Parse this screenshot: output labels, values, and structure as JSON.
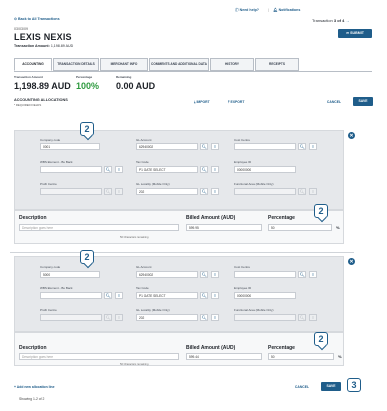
{
  "header": {
    "back_link": "Back to All Transactions",
    "need_help": "Need help?",
    "notifications": "Notifications",
    "transaction_counter_prefix": "Transaction",
    "transaction_counter_value": "3 of 4",
    "date": "03/03/09",
    "title": "LEXIS NEXIS",
    "amount_label": "Transaction Amount:",
    "amount_value": "1,198.89 AUD",
    "submit_label": "SUBMIT"
  },
  "tabs": [
    {
      "label": "ACCOUNTING",
      "active": true
    },
    {
      "label": "TRANSACTION DETAILS",
      "active": false
    },
    {
      "label": "MERCHANT INFO",
      "active": false
    },
    {
      "label": "COMMENTS AND ADDITIONAL DATA",
      "active": false
    },
    {
      "label": "HISTORY",
      "active": false
    },
    {
      "label": "RECEIPTS",
      "active": false
    }
  ],
  "summary": {
    "amount_label": "Transaction Amount",
    "amount_value": "1,198.89 AUD",
    "percentage_label": "Percentage",
    "percentage_value": "100%",
    "remaining_label": "Remaining",
    "remaining_value": "0.00 AUD"
  },
  "allocations_header": {
    "title": "ACCOUNTING ALLOCATIONS",
    "required": "* REQUIRED FIELDS",
    "import": "IMPORT",
    "export": "EXPORT",
    "cancel": "CANCEL",
    "save": "SAVE"
  },
  "allocations": [
    {
      "company_code_label": "Company code",
      "company_code": "0001",
      "gl_account_label": "GL Account",
      "gl_account": "62940002",
      "cost_centre_label": "Cost Centre",
      "cost_centre": "",
      "wbs_label": "WBS Element - Bu Back",
      "wbs": "",
      "tax_code_label": "Tax Code",
      "tax_code": "P1 GATE SELECT",
      "employee_label": "Employee ID",
      "employee": "00000000",
      "profit_centre_label": "Profit Centre",
      "profit_centre": "",
      "gl_locality_label": "GL Locality (Mobile Only)",
      "gl_locality": "202",
      "functional_area_label": "Functional Area (Mobile Only)",
      "functional_area": "",
      "description_label": "Description",
      "description_placeholder": "Description goes here",
      "chars_remaining": "50 Characters remaining",
      "billed_label": "Billed Amount (AUD)",
      "billed_value": "599.95",
      "percentage_label": "Percentage",
      "percentage_value": "50",
      "percent_sign": "%"
    },
    {
      "company_code_label": "Company code",
      "company_code": "5000",
      "gl_account_label": "GL Account",
      "gl_account": "62940002",
      "cost_centre_label": "Cost Centre",
      "cost_centre": "",
      "wbs_label": "WBS Element - Bu Back",
      "wbs": "",
      "tax_code_label": "Tax Code",
      "tax_code": "P1 GATE SELECT",
      "employee_label": "Employee ID",
      "employee": "00000000",
      "profit_centre_label": "Profit Centre",
      "profit_centre": "",
      "gl_locality_label": "GL Locality (Mobile Only)",
      "gl_locality": "202",
      "functional_area_label": "Functional Area (Mobile Only)",
      "functional_area": "",
      "description_label": "Description",
      "description_placeholder": "Description goes here",
      "chars_remaining": "50 Characters remaining",
      "billed_label": "Billed Amount (AUD)",
      "billed_value": "599.44",
      "percentage_label": "Percentage",
      "percentage_value": "50",
      "percent_sign": "%"
    }
  ],
  "footer": {
    "add_allocation": "+ Add new allocation line",
    "showing": "Showing 1-2 of 2",
    "cancel": "CANCEL",
    "save": "SAVE"
  },
  "callouts": {
    "top": "2",
    "bottom": "2",
    "pct_top": "2",
    "pct_bottom": "2",
    "save": "3"
  },
  "icons": {
    "search": "🔍︎",
    "list": "≡",
    "close": "✕"
  },
  "colors": {
    "accent": "#1f5d8a",
    "success": "#2e9a3f"
  }
}
